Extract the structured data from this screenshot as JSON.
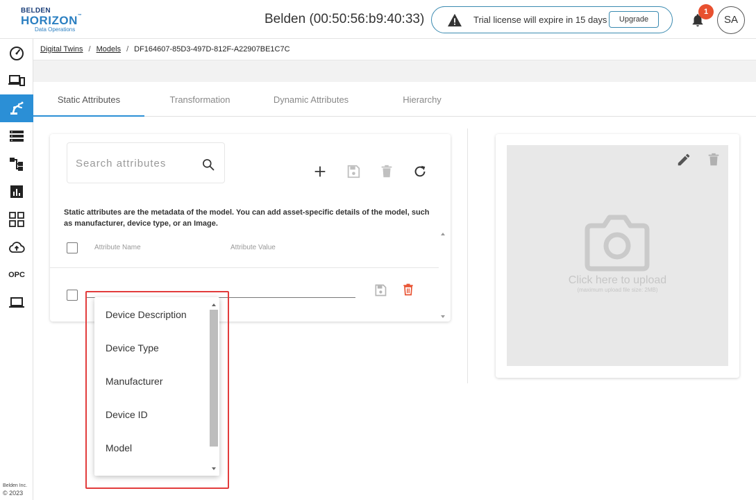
{
  "header": {
    "logo": {
      "brand": "BELDEN",
      "product": "HORIZON",
      "tm": "™",
      "tagline": "Data Operations"
    },
    "device_title": "Belden (00:50:56:b9:40:33)",
    "license_text": "Trial license will expire in 15 days",
    "upgrade_label": "Upgrade",
    "notification_count": "1",
    "avatar_initials": "SA"
  },
  "sidebar": {
    "items": [
      {
        "name": "dashboard",
        "icon": "speedometer-icon"
      },
      {
        "name": "devices",
        "icon": "devices-icon"
      },
      {
        "name": "models",
        "icon": "robot-arm-icon",
        "active": true
      },
      {
        "name": "list",
        "icon": "list-icon"
      },
      {
        "name": "hierarchy",
        "icon": "hierarchy-icon"
      },
      {
        "name": "analytics",
        "icon": "chart-icon"
      },
      {
        "name": "apps",
        "icon": "grid-icon"
      },
      {
        "name": "upload",
        "icon": "cloud-upload-icon"
      },
      {
        "name": "opc",
        "label": "OPC"
      },
      {
        "name": "laptop",
        "icon": "laptop-icon"
      }
    ],
    "copyright_company": "Belden Inc.",
    "copyright_year": "© 2023",
    "active_color": "#2b8fd6"
  },
  "breadcrumb": {
    "items": [
      "Digital Twins",
      "Models"
    ],
    "current": "DF164607-85D3-497D-812F-A22907BE1C7C"
  },
  "tabs": [
    {
      "label": "Static Attributes",
      "active": true
    },
    {
      "label": "Transformation"
    },
    {
      "label": "Dynamic Attributes"
    },
    {
      "label": "Hierarchy"
    }
  ],
  "attributes": {
    "search_placeholder": "Search attributes",
    "description": "Static attributes are the metadata of the model. You can add asset-specific details of the model, such as manufacturer, device type, or an Image.",
    "col_name": "Attribute Name",
    "col_value": "Attribute Value",
    "dropdown_options": [
      "Device Description",
      "Device Type",
      "Manufacturer",
      "Device ID",
      "Model"
    ],
    "delete_color": "#e8502f"
  },
  "image": {
    "upload_text": "Click here to upload",
    "upload_sub": "(maximum upload file size: 2MB)"
  }
}
